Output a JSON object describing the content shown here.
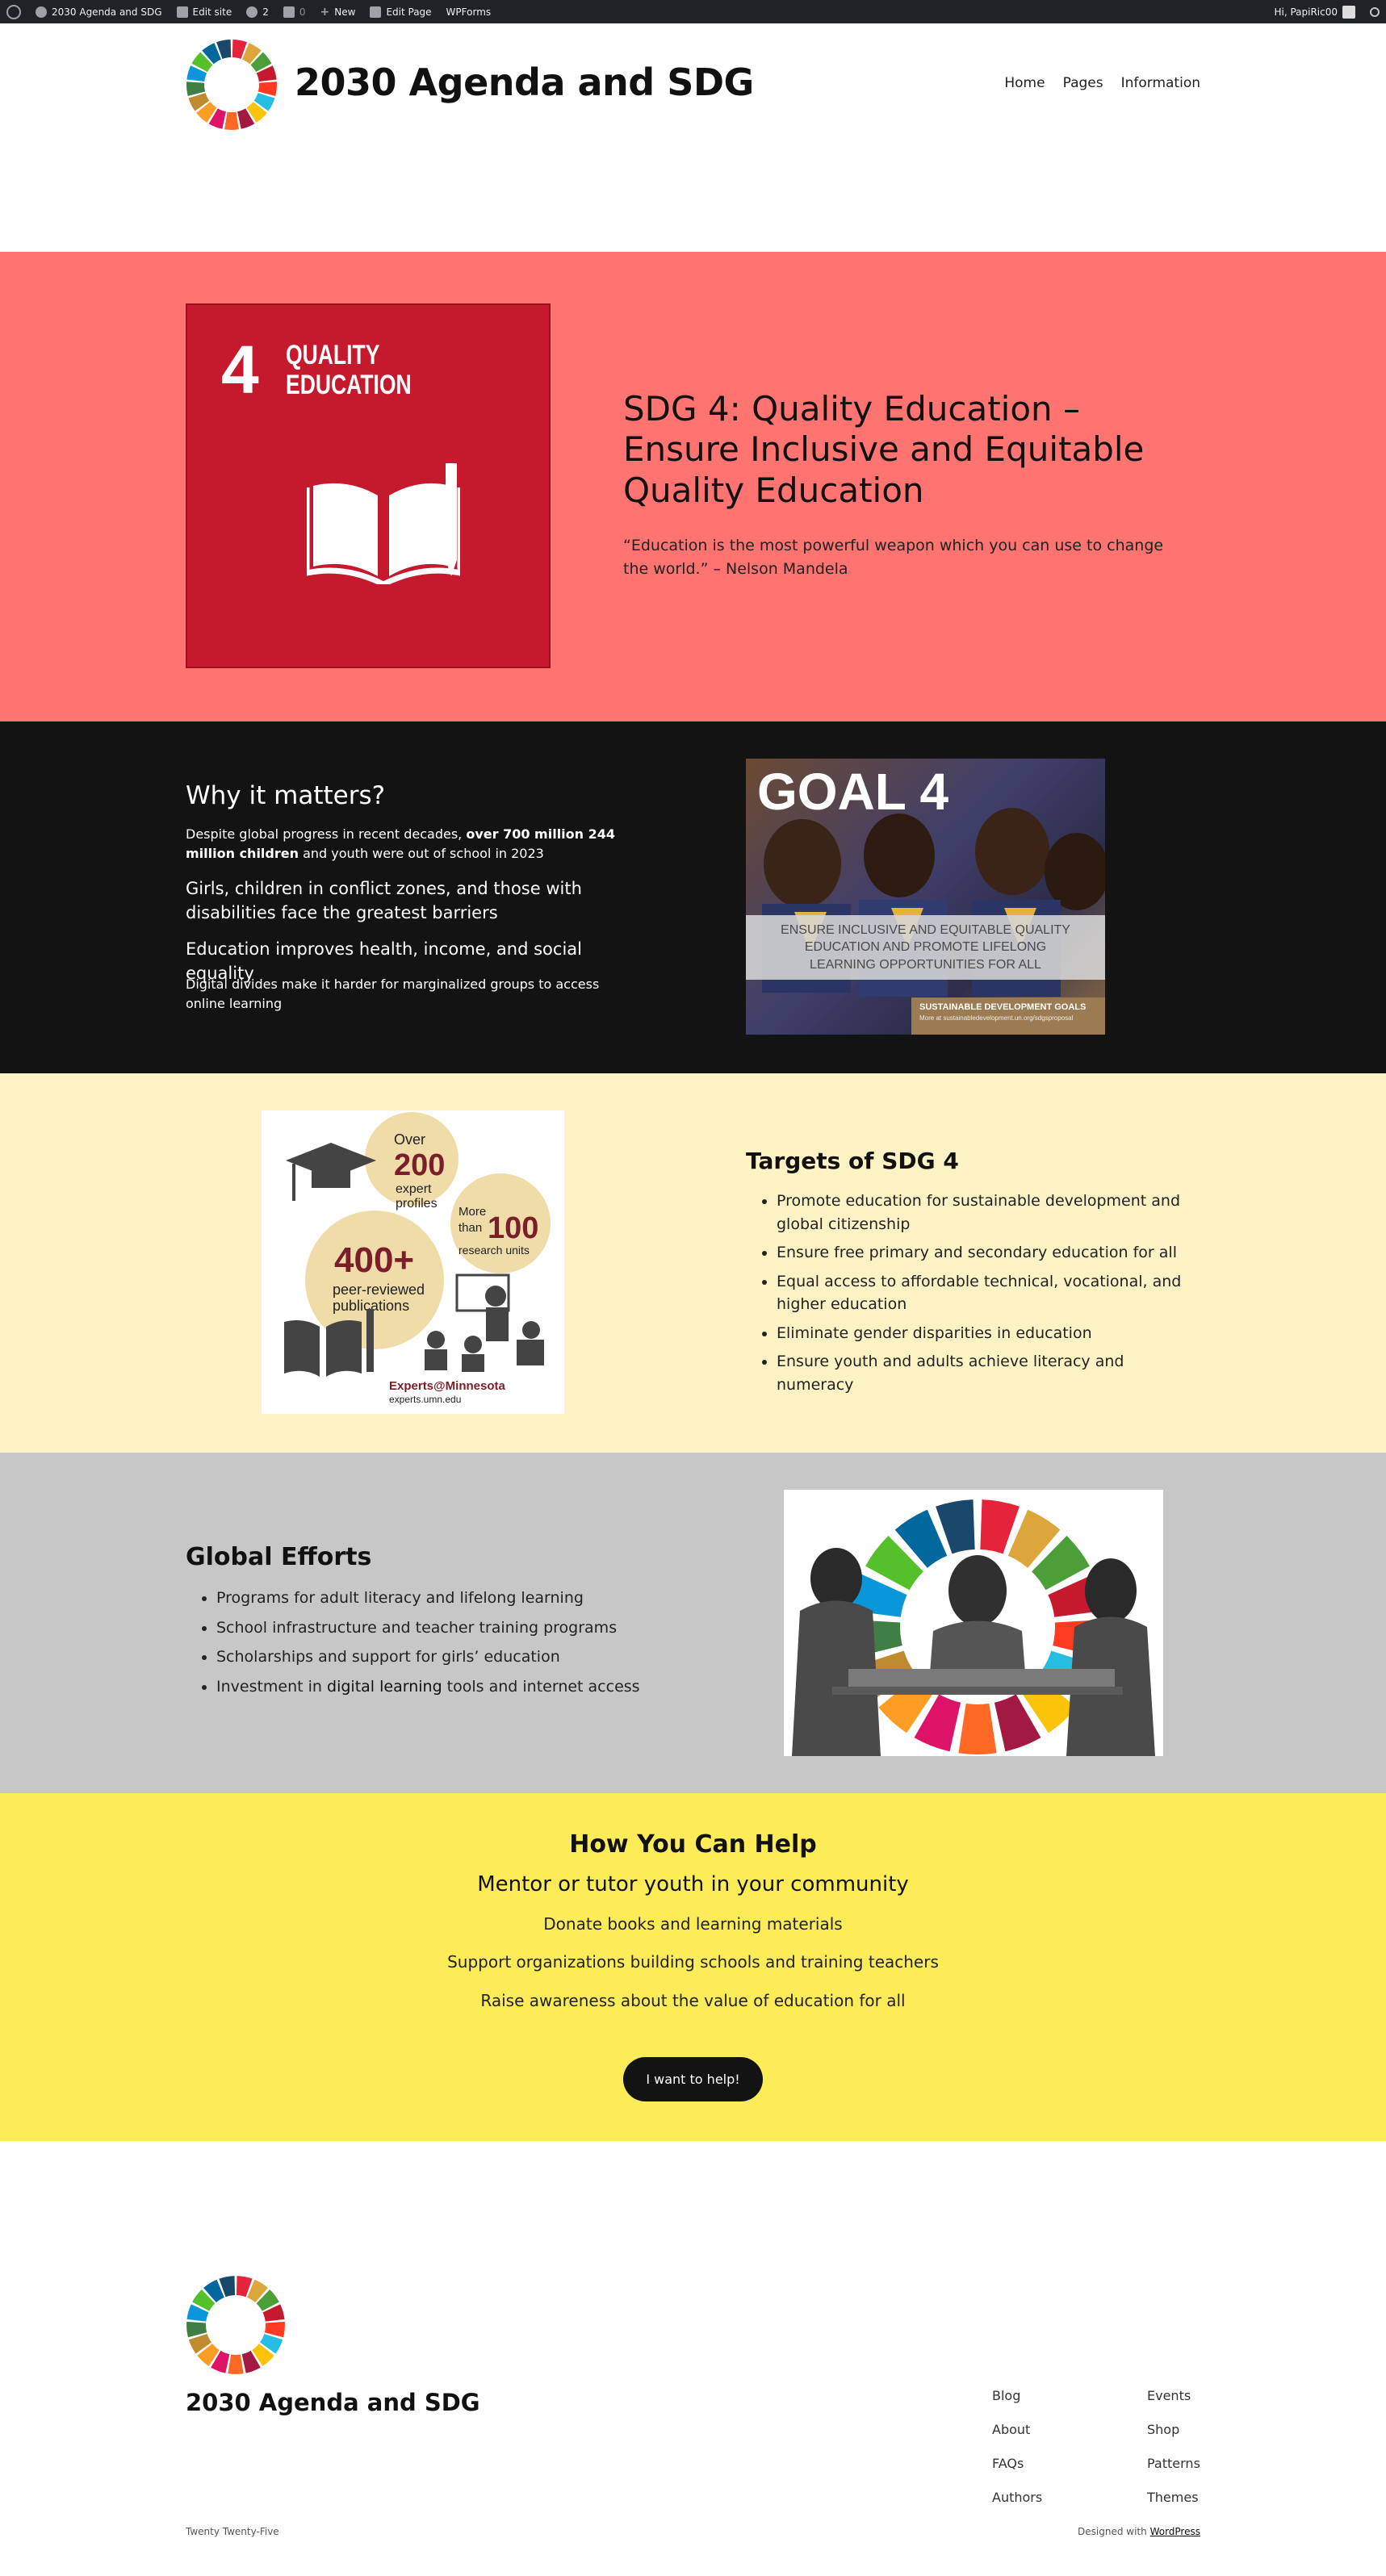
{
  "admin_bar": {
    "site_name": "2030 Agenda and SDG",
    "edit_site": "Edit site",
    "updates_count": "2",
    "comments_count": "0",
    "new_label": "New",
    "edit_page": "Edit Page",
    "wpforms": "WPForms",
    "greeting": "Hi, PapiRic00"
  },
  "header": {
    "site_title": "2030 Agenda and SDG",
    "nav": [
      "Home",
      "Pages",
      "Information"
    ]
  },
  "hero": {
    "background": "#ff7370",
    "card_number": "4",
    "card_label_line1": "QUALITY",
    "card_label_line2": "EDUCATION",
    "card_color": "#c5192d",
    "title": "SDG 4: Quality Education – Ensure Inclusive and Equitable Quality Education",
    "quote": "“Education is the most powerful weapon which you can use to change the world.” – Nelson Mandela"
  },
  "why": {
    "heading": "Why it matters?",
    "p1_prefix": "Despite global progress in recent decades, ",
    "p1_bold": "over 700 million 244 million children",
    "p1_suffix": " and youth were out of school in 2023",
    "p2": "Girls, children in conflict zones, and those with disabilities face the greatest barriers",
    "p3": "Education improves health, income, and social equality",
    "p4": "Digital divides make it harder for marginalized groups to access online learning",
    "image": {
      "title": "GOAL 4",
      "band_text": "ENSURE INCLUSIVE AND EQUITABLE QUALITY EDUCATION AND PROMOTE LIFELONG LEARNING OPPORTUNITIES FOR ALL",
      "badge_title": "SUSTAINABLE DEVELOPMENT GOALS",
      "badge_sub": "More at sustainabledevelopment.un.org/sdgsproposal"
    }
  },
  "targets": {
    "image": {
      "over": "Over",
      "n200": "200",
      "expert_profiles_1": "expert",
      "expert_profiles_2": "profiles",
      "more": "More",
      "than": "than",
      "n100": "100",
      "research_units": "research units",
      "n400": "400+",
      "peer_1": "peer-reviewed",
      "peer_2": "publications",
      "brand": "Experts@Minnesota",
      "url": "experts.umn.edu"
    },
    "heading": "Targets of SDG 4",
    "items": [
      "Promote education for sustainable development and global citizenship",
      "Ensure free primary and secondary education for all",
      "Equal access to affordable technical, vocational, and higher education",
      "Eliminate gender disparities in education",
      "Ensure youth and adults achieve literacy and numeracy"
    ]
  },
  "global": {
    "heading": "Global Efforts",
    "items": [
      "Programs for adult literacy and lifelong learning",
      "School infrastructure and teacher training programs",
      "Scholarships and support for girls’ education"
    ],
    "item4_prefix": "Investment in ",
    "item4_mid": "digital learning",
    "item4_suffix": " tools and internet access"
  },
  "help": {
    "heading": "How You Can Help",
    "line1": "Mentor or tutor youth in your community",
    "line2": "Donate books and learning materials",
    "line3": "Support organizations building schools and training teachers",
    "line4": "Raise awareness about the value of education for all",
    "button": "I want to help!"
  },
  "footer": {
    "site_title": "2030 Agenda and SDG",
    "col1": [
      "Blog",
      "About",
      "FAQs",
      "Authors"
    ],
    "col2": [
      "Events",
      "Shop",
      "Patterns",
      "Themes"
    ],
    "theme_name": "Twenty Twenty-Five",
    "designed_prefix": "Designed with ",
    "designed_link": "WordPress"
  },
  "colors": {
    "sdg_wheel": [
      "#e5243b",
      "#dda63a",
      "#4c9f38",
      "#c5192d",
      "#ff3a21",
      "#26bde2",
      "#fcc30b",
      "#a21942",
      "#fd6925",
      "#dd1367",
      "#fd9d24",
      "#bf8b2e",
      "#3f7e44",
      "#0a97d9",
      "#56c02b",
      "#00689d",
      "#19486a"
    ]
  }
}
